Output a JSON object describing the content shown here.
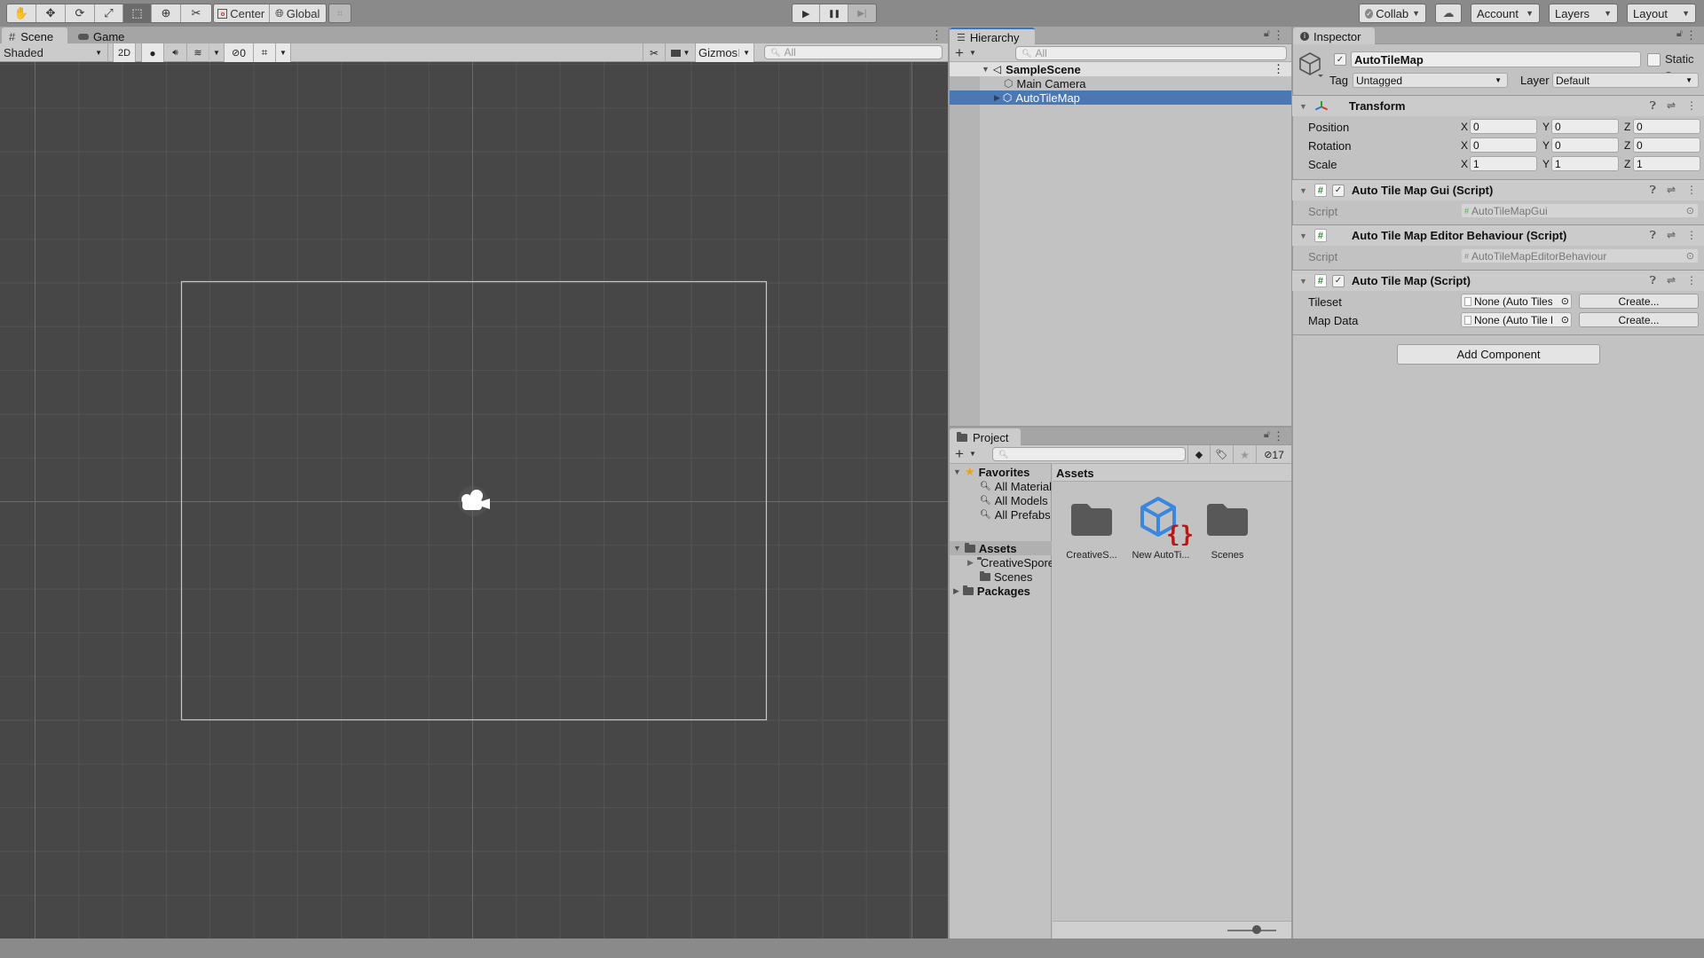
{
  "toolbar": {
    "tools": [
      {
        "name": "hand-tool",
        "glyph": "✋"
      },
      {
        "name": "move-tool",
        "glyph": "✥"
      },
      {
        "name": "rotate-tool",
        "glyph": "⟳"
      },
      {
        "name": "scale-tool",
        "glyph": "⤢"
      },
      {
        "name": "rect-tool",
        "glyph": "⬚"
      },
      {
        "name": "transform-tool",
        "glyph": "⊕"
      },
      {
        "name": "custom-tool",
        "glyph": "✂"
      }
    ],
    "pivot_mode": "Center",
    "pivot_rotation": "Global",
    "play_icon": "▶",
    "pause_icon": "❚❚",
    "step_icon": "▶|",
    "collab": "Collab",
    "account": "Account",
    "layers": "Layers",
    "layout": "Layout"
  },
  "scene": {
    "tabs": [
      {
        "label": "Scene",
        "icon": "#"
      },
      {
        "label": "Game",
        "icon": "🎮"
      }
    ],
    "shading_mode": "Shaded",
    "mode_2d": "2D",
    "hidden_count": "0",
    "gizmos": "Gizmos",
    "search_placeholder": "All"
  },
  "hierarchy": {
    "title": "Hierarchy",
    "search_placeholder": "All",
    "scene_name": "SampleScene",
    "items": [
      {
        "label": "Main Camera",
        "selected": false,
        "expandable": false
      },
      {
        "label": "AutoTileMap",
        "selected": true,
        "expandable": true
      }
    ]
  },
  "project": {
    "title": "Project",
    "hidden_count": "17",
    "favorites": {
      "label": "Favorites",
      "items": [
        "All Materials",
        "All Models",
        "All Prefabs"
      ]
    },
    "assets": {
      "label": "Assets",
      "children": [
        "CreativeSpore",
        "Scenes"
      ]
    },
    "packages": "Packages",
    "breadcrumb": "Assets",
    "grid_items": [
      {
        "label": "CreativeS...",
        "type": "folder"
      },
      {
        "label": "New AutoTi...",
        "type": "prefab-script"
      },
      {
        "label": "Scenes",
        "type": "folder"
      }
    ],
    "zoom_level": 0.6
  },
  "inspector": {
    "title": "Inspector",
    "object_name": "AutoTileMap",
    "active": true,
    "static_label": "Static",
    "tag_label": "Tag",
    "tag_value": "Untagged",
    "layer_label": "Layer",
    "layer_value": "Default",
    "transform": {
      "title": "Transform",
      "rows": [
        {
          "label": "Position",
          "x": "0",
          "y": "0",
          "z": "0"
        },
        {
          "label": "Rotation",
          "x": "0",
          "y": "0",
          "z": "0"
        },
        {
          "label": "Scale",
          "x": "1",
          "y": "1",
          "z": "1"
        }
      ]
    },
    "components": [
      {
        "title": "Auto Tile Map Gui (Script)",
        "has_checkbox": true,
        "field_label": "Script",
        "field_value": "AutoTileMapGui"
      },
      {
        "title": "Auto Tile Map Editor Behaviour (Script)",
        "has_checkbox": false,
        "field_label": "Script",
        "field_value": "AutoTileMapEditorBehaviour"
      },
      {
        "title": "Auto Tile Map (Script)",
        "has_checkbox": true,
        "fields": [
          {
            "label": "Tileset",
            "value": "None (Auto Tileset)",
            "button": "Create..."
          },
          {
            "label": "Map Data",
            "value": "None (Auto Tile Map Data)",
            "button": "Create..."
          }
        ]
      }
    ],
    "add_component": "Add Component"
  },
  "colors": {
    "selection": "#4a78b4",
    "scene_bg": "#474747",
    "accent_tab": "#3a72c4",
    "script_green": "#2e8b2e",
    "script_red": "#b01c1c",
    "prefab_blue": "#3a86e0"
  }
}
